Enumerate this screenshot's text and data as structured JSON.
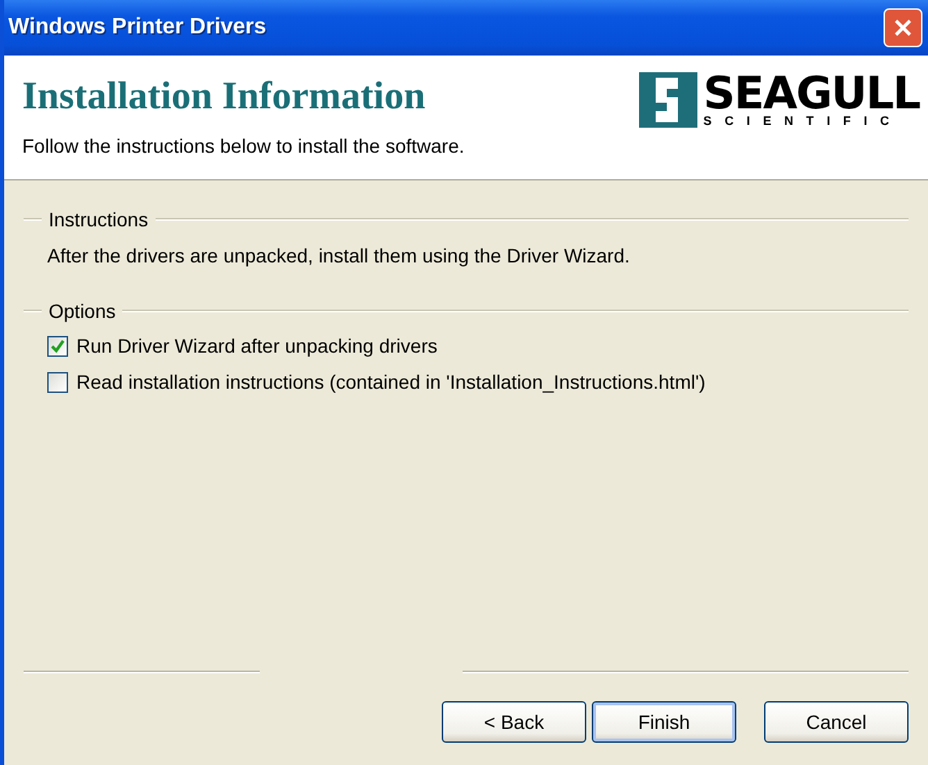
{
  "window": {
    "title": "Windows Printer Drivers"
  },
  "header": {
    "title": "Installation Information",
    "subtitle": "Follow the instructions below to install the software.",
    "logo": {
      "name": "SEAGULL",
      "tagline": "SCIENTIFIC"
    }
  },
  "groups": [
    {
      "kind": "text",
      "label": "Instructions",
      "text": "After the drivers are unpacked, install them using the Driver Wizard."
    },
    {
      "kind": "options",
      "label": "Options",
      "options": [
        {
          "label": "Run Driver Wizard after unpacking drivers",
          "checked": true
        },
        {
          "label": "Read installation instructions (contained in 'Installation_Instructions.html')",
          "checked": false
        }
      ]
    }
  ],
  "buttons": [
    {
      "label": "< Back",
      "default": false
    },
    {
      "label": "Finish",
      "default": true
    },
    {
      "label": "Cancel",
      "default": false
    }
  ]
}
